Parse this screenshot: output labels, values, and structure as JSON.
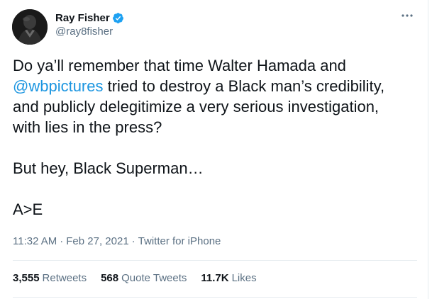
{
  "author": {
    "display_name": "Ray Fisher",
    "handle": "@ray8fisher",
    "verified": true,
    "verified_color": "#1da1f2"
  },
  "tweet": {
    "line1": "Do ya’ll remember that time Walter Hamada and",
    "mention": "@wbpictures",
    "line2_rest": " tried to destroy a Black man’s credibility,",
    "line3": "and publicly delegitimize a very serious investigation,",
    "line4": "with lies in the press?",
    "line5": "But hey, Black Superman…",
    "line6": "A>E"
  },
  "meta": {
    "time": "11:32 AM",
    "separator": "·",
    "date": "Feb 27, 2021",
    "source": "Twitter for iPhone"
  },
  "stats": {
    "retweets_count": "3,555",
    "retweets_label": "Retweets",
    "quotes_count": "568",
    "quotes_label": "Quote Tweets",
    "likes_count": "11.7K",
    "likes_label": "Likes"
  },
  "colors": {
    "link": "#1b95e0",
    "secondary_text": "#5b7083",
    "primary_text": "#0f1419"
  },
  "icons": {
    "more": "more-horizontal-icon",
    "verified": "verified-badge-icon"
  }
}
